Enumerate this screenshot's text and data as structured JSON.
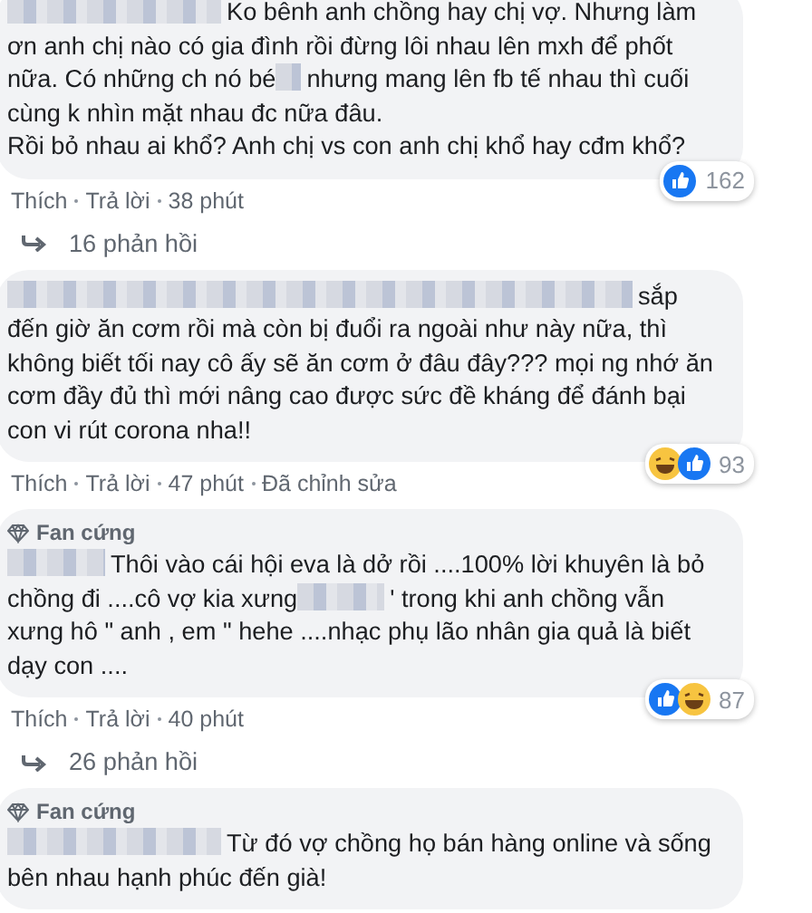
{
  "comments": [
    {
      "body": [
        {
          "kind": "redacted"
        },
        {
          "kind": "text",
          "text": "Ko bênh anh chồng hay chị vợ. Nhưng làm ơn anh chị nào có gia đình rồi đừng lôi nhau lên mxh để phốt nữa. Có những ch nó bé"
        },
        {
          "kind": "redacted"
        },
        {
          "kind": "text",
          "text": "nhưng mang lên fb tế nhau thì cuối cùng k nhìn mặt nhau đc nữa đâu.\nRồi bỏ nhau ai khổ? Anh chị vs con anh chị khổ hay cđm khổ?"
        }
      ],
      "reactions": [
        {
          "kind": "like"
        }
      ],
      "reaction_count": "162",
      "actions": [
        "Thích",
        "Trả lời",
        "38 phút"
      ],
      "replies": "16 phản hồi"
    },
    {
      "body": [
        {
          "kind": "redacted"
        },
        {
          "kind": "text",
          "text": "sắp đến giờ ăn cơm rồi mà còn bị đuổi ra ngoài như này nữa, thì không biết tối nay cô ấy sẽ ăn cơm ở đâu đây??? mọi ng nhớ ăn cơm đầy đủ thì mới nâng cao được sức đề kháng để đánh bại con vi rút corona nha!!"
        }
      ],
      "reactions": [
        {
          "kind": "haha"
        },
        {
          "kind": "like"
        }
      ],
      "reaction_count": "93",
      "actions": [
        "Thích",
        "Trả lời",
        "47 phút",
        "Đã chỉnh sửa"
      ]
    },
    {
      "badge": "Fan cứng",
      "body": [
        {
          "kind": "redacted"
        },
        {
          "kind": "text",
          "text": "Thôi vào cái hội eva là dở rồi ....100% lời khuyên là bỏ chồng đi ....cô vợ kia xưng"
        },
        {
          "kind": "redacted"
        },
        {
          "kind": "text",
          "text": "' trong khi anh chồng vẫn xưng hô \" anh , em \" hehe ....nhạc phụ lão nhân gia quả là biết dạy con ...."
        }
      ],
      "reactions": [
        {
          "kind": "like"
        },
        {
          "kind": "haha"
        }
      ],
      "reaction_count": "87",
      "actions": [
        "Thích",
        "Trả lời",
        "40 phút"
      ],
      "replies": "26 phản hồi"
    },
    {
      "badge": "Fan cứng",
      "body": [
        {
          "kind": "redacted"
        },
        {
          "kind": "text",
          "text": "Từ đó vợ chồng họ bán hàng online và sống bên nhau hạnh phúc đến già!"
        }
      ]
    }
  ]
}
